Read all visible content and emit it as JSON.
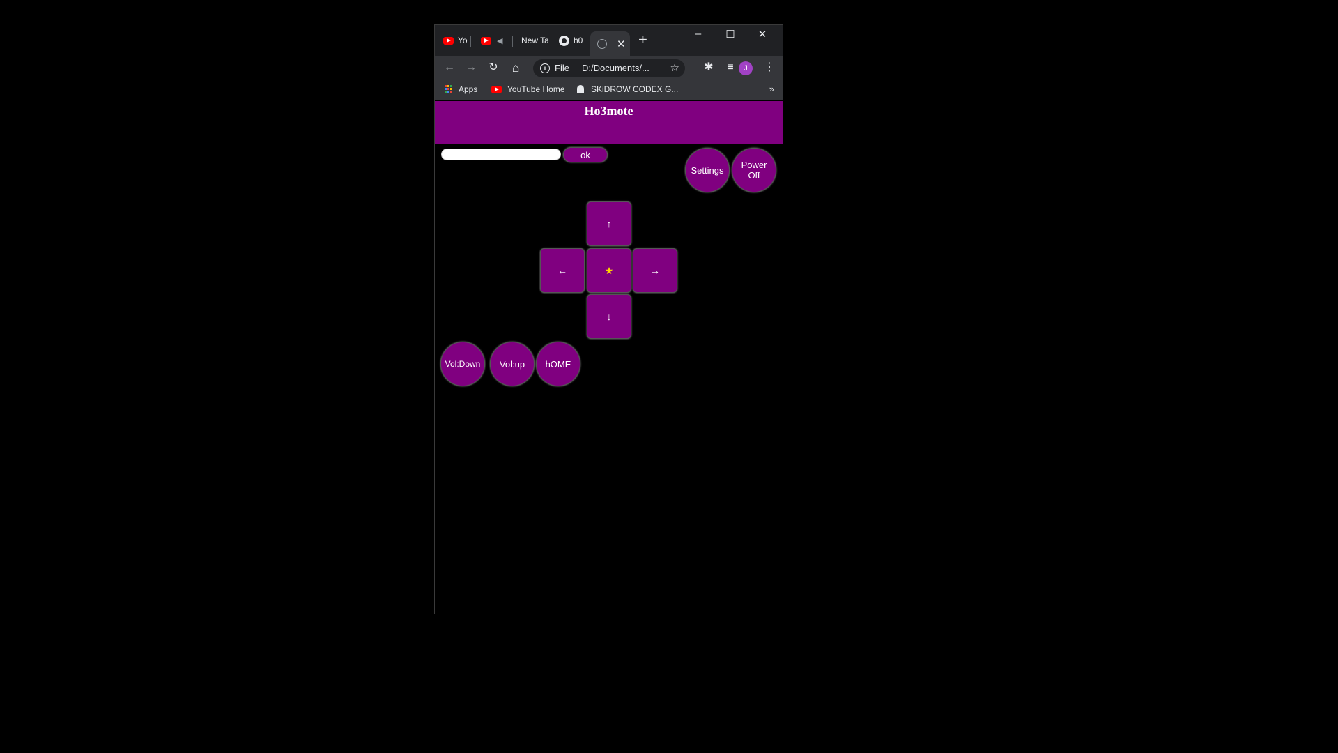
{
  "browser": {
    "tabs": [
      {
        "label": "Yo",
        "icon": "youtube-icon"
      },
      {
        "label": "",
        "icon": "youtube-icon"
      },
      {
        "label": "New Ta"
      },
      {
        "label": "h0",
        "icon": "github-icon"
      },
      {
        "label": "",
        "icon": "globe-icon",
        "active": true
      }
    ],
    "new_tab": "+",
    "window_controls": {
      "minimize": "–",
      "maximize": "☐",
      "close": "✕"
    },
    "toolbar": {
      "back": "←",
      "forward": "→",
      "reload": "↻",
      "home": "⌂",
      "omnibox_scheme": "File",
      "omnibox_url": "D:/Documents/...",
      "avatar_letter": "J"
    },
    "bookmarks": [
      {
        "label": "Apps",
        "icon": "apps-icon"
      },
      {
        "label": "YouTube Home",
        "icon": "youtube-icon"
      },
      {
        "label": "SKiDROW CODEX G...",
        "icon": "ghost-icon"
      }
    ],
    "bookmarks_more": "»"
  },
  "app": {
    "title": "Ho3mote",
    "ok_label": "ok",
    "settings_label": "Settings",
    "power_line1": "Power",
    "power_line2": "Off",
    "dpad": {
      "up": "↑",
      "left": "←",
      "center": "★",
      "right": "→",
      "down": "↓"
    },
    "vol_down_label": "Vol:Down",
    "vol_up_label": "Vol:up",
    "home_label": "hOME"
  },
  "colors": {
    "accent": "#800080",
    "star": "#ffd700",
    "chrome_dark": "#202124",
    "chrome": "#35363a"
  }
}
